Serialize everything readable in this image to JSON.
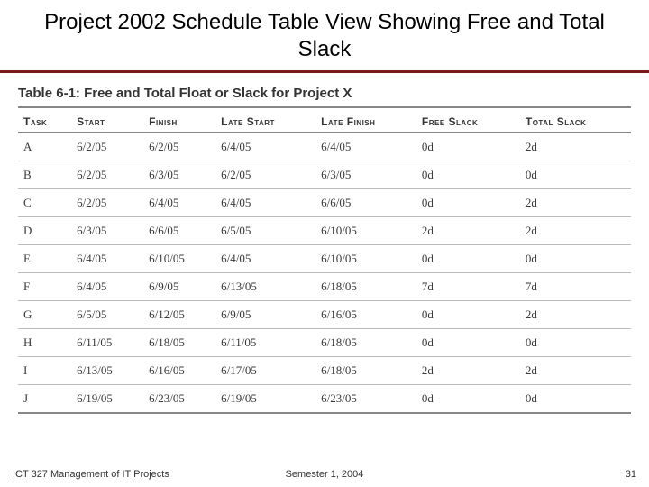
{
  "title": "Project 2002 Schedule Table View Showing Free and Total Slack",
  "table": {
    "caption": "Table 6-1: Free and Total Float or Slack for Project X",
    "columns": [
      "Task",
      "Start",
      "Finish",
      "Late Start",
      "Late Finish",
      "Free Slack",
      "Total Slack"
    ],
    "rows": [
      {
        "task": "A",
        "start": "6/2/05",
        "finish": "6/2/05",
        "late_start": "6/4/05",
        "late_finish": "6/4/05",
        "free_slack": "0d",
        "total_slack": "2d"
      },
      {
        "task": "B",
        "start": "6/2/05",
        "finish": "6/3/05",
        "late_start": "6/2/05",
        "late_finish": "6/3/05",
        "free_slack": "0d",
        "total_slack": "0d"
      },
      {
        "task": "C",
        "start": "6/2/05",
        "finish": "6/4/05",
        "late_start": "6/4/05",
        "late_finish": "6/6/05",
        "free_slack": "0d",
        "total_slack": "2d"
      },
      {
        "task": "D",
        "start": "6/3/05",
        "finish": "6/6/05",
        "late_start": "6/5/05",
        "late_finish": "6/10/05",
        "free_slack": "2d",
        "total_slack": "2d"
      },
      {
        "task": "E",
        "start": "6/4/05",
        "finish": "6/10/05",
        "late_start": "6/4/05",
        "late_finish": "6/10/05",
        "free_slack": "0d",
        "total_slack": "0d"
      },
      {
        "task": "F",
        "start": "6/4/05",
        "finish": "6/9/05",
        "late_start": "6/13/05",
        "late_finish": "6/18/05",
        "free_slack": "7d",
        "total_slack": "7d"
      },
      {
        "task": "G",
        "start": "6/5/05",
        "finish": "6/12/05",
        "late_start": "6/9/05",
        "late_finish": "6/16/05",
        "free_slack": "0d",
        "total_slack": "2d"
      },
      {
        "task": "H",
        "start": "6/11/05",
        "finish": "6/18/05",
        "late_start": "6/11/05",
        "late_finish": "6/18/05",
        "free_slack": "0d",
        "total_slack": "0d"
      },
      {
        "task": "I",
        "start": "6/13/05",
        "finish": "6/16/05",
        "late_start": "6/17/05",
        "late_finish": "6/18/05",
        "free_slack": "2d",
        "total_slack": "2d"
      },
      {
        "task": "J",
        "start": "6/19/05",
        "finish": "6/23/05",
        "late_start": "6/19/05",
        "late_finish": "6/23/05",
        "free_slack": "0d",
        "total_slack": "0d"
      }
    ]
  },
  "footer": {
    "left": "ICT 327 Management of IT Projects",
    "center": "Semester 1, 2004",
    "right": "31"
  }
}
